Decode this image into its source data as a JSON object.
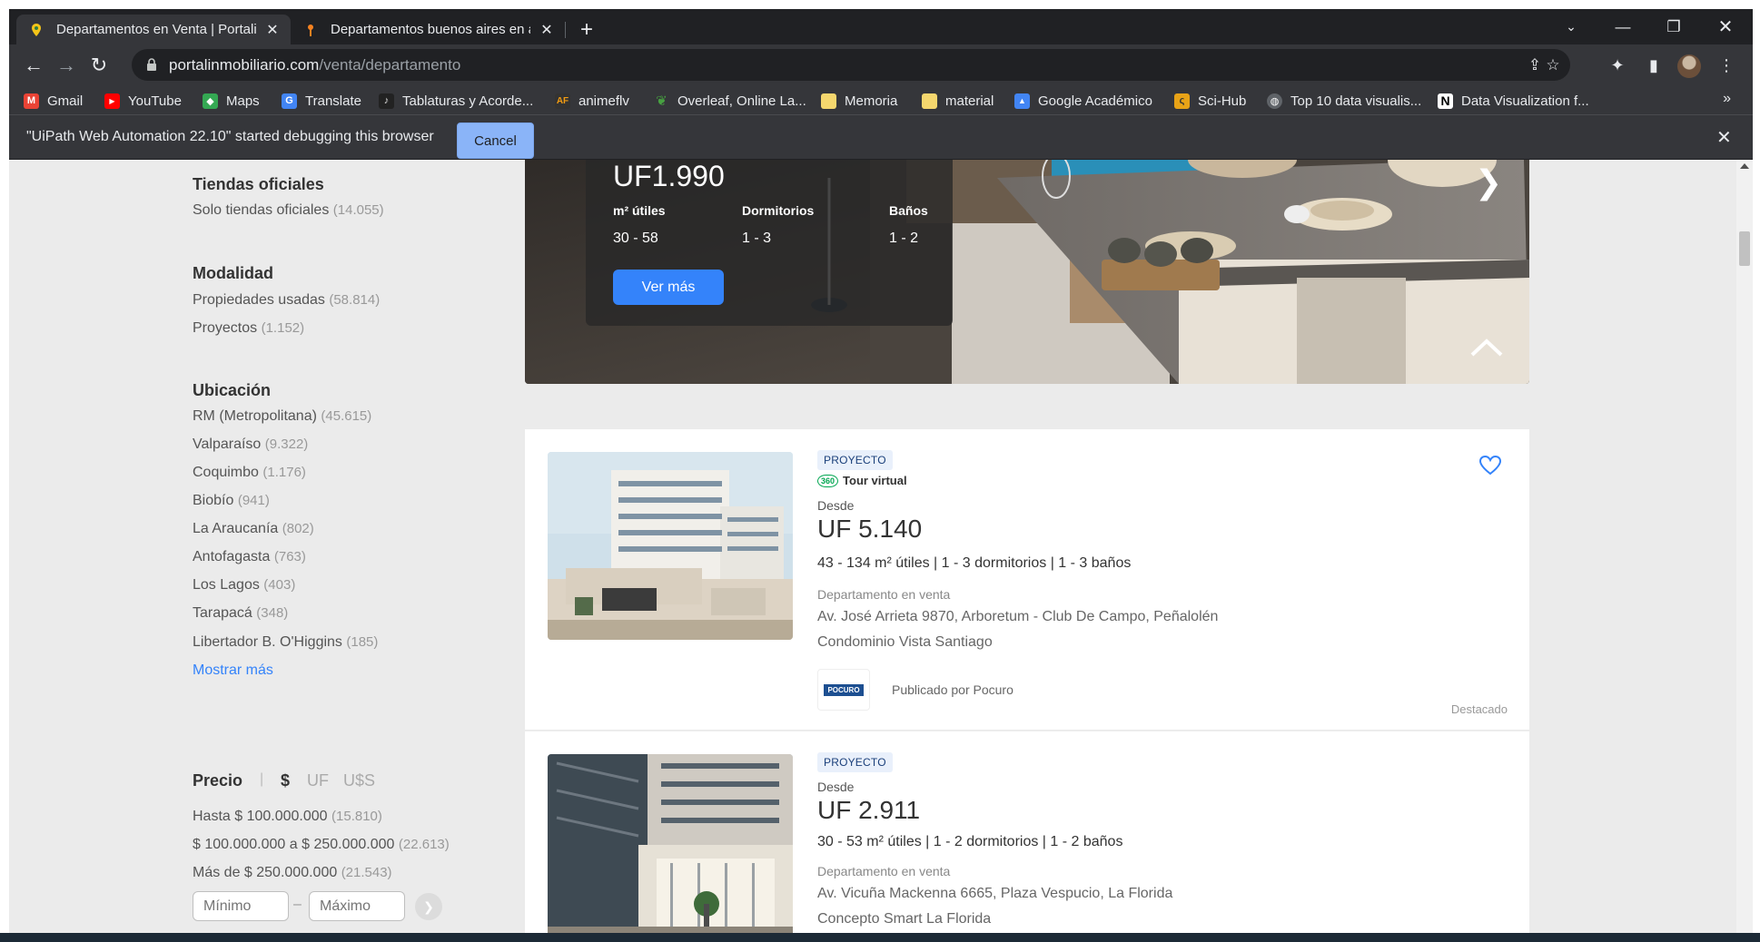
{
  "tabs": [
    {
      "title": "Departamentos en Venta | Portalinmobiliario",
      "active": true
    },
    {
      "title": "Departamentos buenos aires en arriendo",
      "active": false
    }
  ],
  "toolbar": {
    "url_host": "portalinmobiliario.com",
    "url_path": "/venta/departamento"
  },
  "bookmarks": [
    {
      "label": "Gmail",
      "icon": "gmail-icon",
      "color": "#ea4335"
    },
    {
      "label": "YouTube",
      "icon": "youtube-icon",
      "color": "#ff0000"
    },
    {
      "label": "Maps",
      "icon": "maps-icon",
      "color": "#34a853"
    },
    {
      "label": "Translate",
      "icon": "translate-icon",
      "color": "#4285f4"
    },
    {
      "label": "Tablaturas y Acorde...",
      "icon": "guitar-icon",
      "color": "#333333"
    },
    {
      "label": "animeflv",
      "icon": "animeflv-icon",
      "color": "#b03a2e"
    },
    {
      "label": "Overleaf, Online La...",
      "icon": "overleaf-icon",
      "color": "#47a141"
    },
    {
      "label": "Memoria",
      "icon": "folder-icon",
      "color": "#f5d76e"
    },
    {
      "label": "material",
      "icon": "folder-icon",
      "color": "#f5d76e"
    },
    {
      "label": "Google Académico",
      "icon": "scholar-icon",
      "color": "#4285f4"
    },
    {
      "label": "Sci-Hub",
      "icon": "scihub-icon",
      "color": "#e8a317"
    },
    {
      "label": "Top 10 data visualis...",
      "icon": "globe-icon",
      "color": "#9aa0a6"
    },
    {
      "label": "Data Visualization f...",
      "icon": "notion-icon",
      "color": "#000000"
    }
  ],
  "infobar": {
    "message": "\"UiPath Web Automation 22.10\" started debugging this browser",
    "cancel_label": "Cancel"
  },
  "filters": {
    "tiendas": {
      "title": "Tiendas oficiales",
      "items": [
        {
          "label": "Solo tiendas oficiales",
          "count": "(14.055)"
        }
      ]
    },
    "modalidad": {
      "title": "Modalidad",
      "items": [
        {
          "label": "Propiedades usadas",
          "count": "(58.814)"
        },
        {
          "label": "Proyectos",
          "count": "(1.152)"
        }
      ]
    },
    "ubicacion": {
      "title": "Ubicación",
      "items": [
        {
          "label": "RM (Metropolitana)",
          "count": "(45.615)"
        },
        {
          "label": "Valparaíso",
          "count": "(9.322)"
        },
        {
          "label": "Coquimbo",
          "count": "(1.176)"
        },
        {
          "label": "Biobío",
          "count": "(941)"
        },
        {
          "label": "La Araucanía",
          "count": "(802)"
        },
        {
          "label": "Antofagasta",
          "count": "(763)"
        },
        {
          "label": "Los Lagos",
          "count": "(403)"
        },
        {
          "label": "Tarapacá",
          "count": "(348)"
        },
        {
          "label": "Libertador B. O'Higgins",
          "count": "(185)"
        }
      ],
      "more_label": "Mostrar más"
    },
    "precio": {
      "title": "Precio",
      "sep": "|",
      "currencies": [
        "$",
        "UF",
        "U$S"
      ],
      "items": [
        {
          "label": "Hasta $ 100.000.000",
          "count": "(15.810)"
        },
        {
          "label": "$ 100.000.000 a $ 250.000.000",
          "count": "(22.613)"
        },
        {
          "label": "Más de $ 250.000.000",
          "count": "(21.543)"
        }
      ],
      "min_placeholder": "Mínimo",
      "dash": "–",
      "max_placeholder": "Máximo",
      "go_icon": "chevron-right-icon"
    }
  },
  "hero": {
    "price": "UF1.990",
    "labels": [
      "m² útiles",
      "Dormitorios",
      "Baños"
    ],
    "values": [
      "30 - 58",
      "1 - 3",
      "1 - 2"
    ],
    "button_label": "Ver más"
  },
  "listings": [
    {
      "badge": "PROYECTO",
      "tour": "Tour virtual",
      "tour_badge": "360",
      "desde": "Desde",
      "price": "UF 5.140",
      "attrs": "43 - 134 m² útiles | 1 - 3 dormitorios | 1 - 3 baños",
      "type": "Departamento en venta",
      "address": "Av. José Arrieta 9870, Arboretum - Club De Campo, Peñalolén",
      "name": "Condominio Vista Santiago",
      "logo": "POCURO",
      "published_by": "Publicado por Pocuro",
      "featured": "Destacado"
    },
    {
      "badge": "PROYECTO",
      "desde": "Desde",
      "price": "UF 2.911",
      "attrs": "30 - 53 m² útiles | 1 - 2 dormitorios | 1 - 2 baños",
      "type": "Departamento en venta",
      "address": "Av. Vicuña Mackenna 6665, Plaza Vespucio, La Florida",
      "name": "Concepto Smart La Florida"
    }
  ]
}
